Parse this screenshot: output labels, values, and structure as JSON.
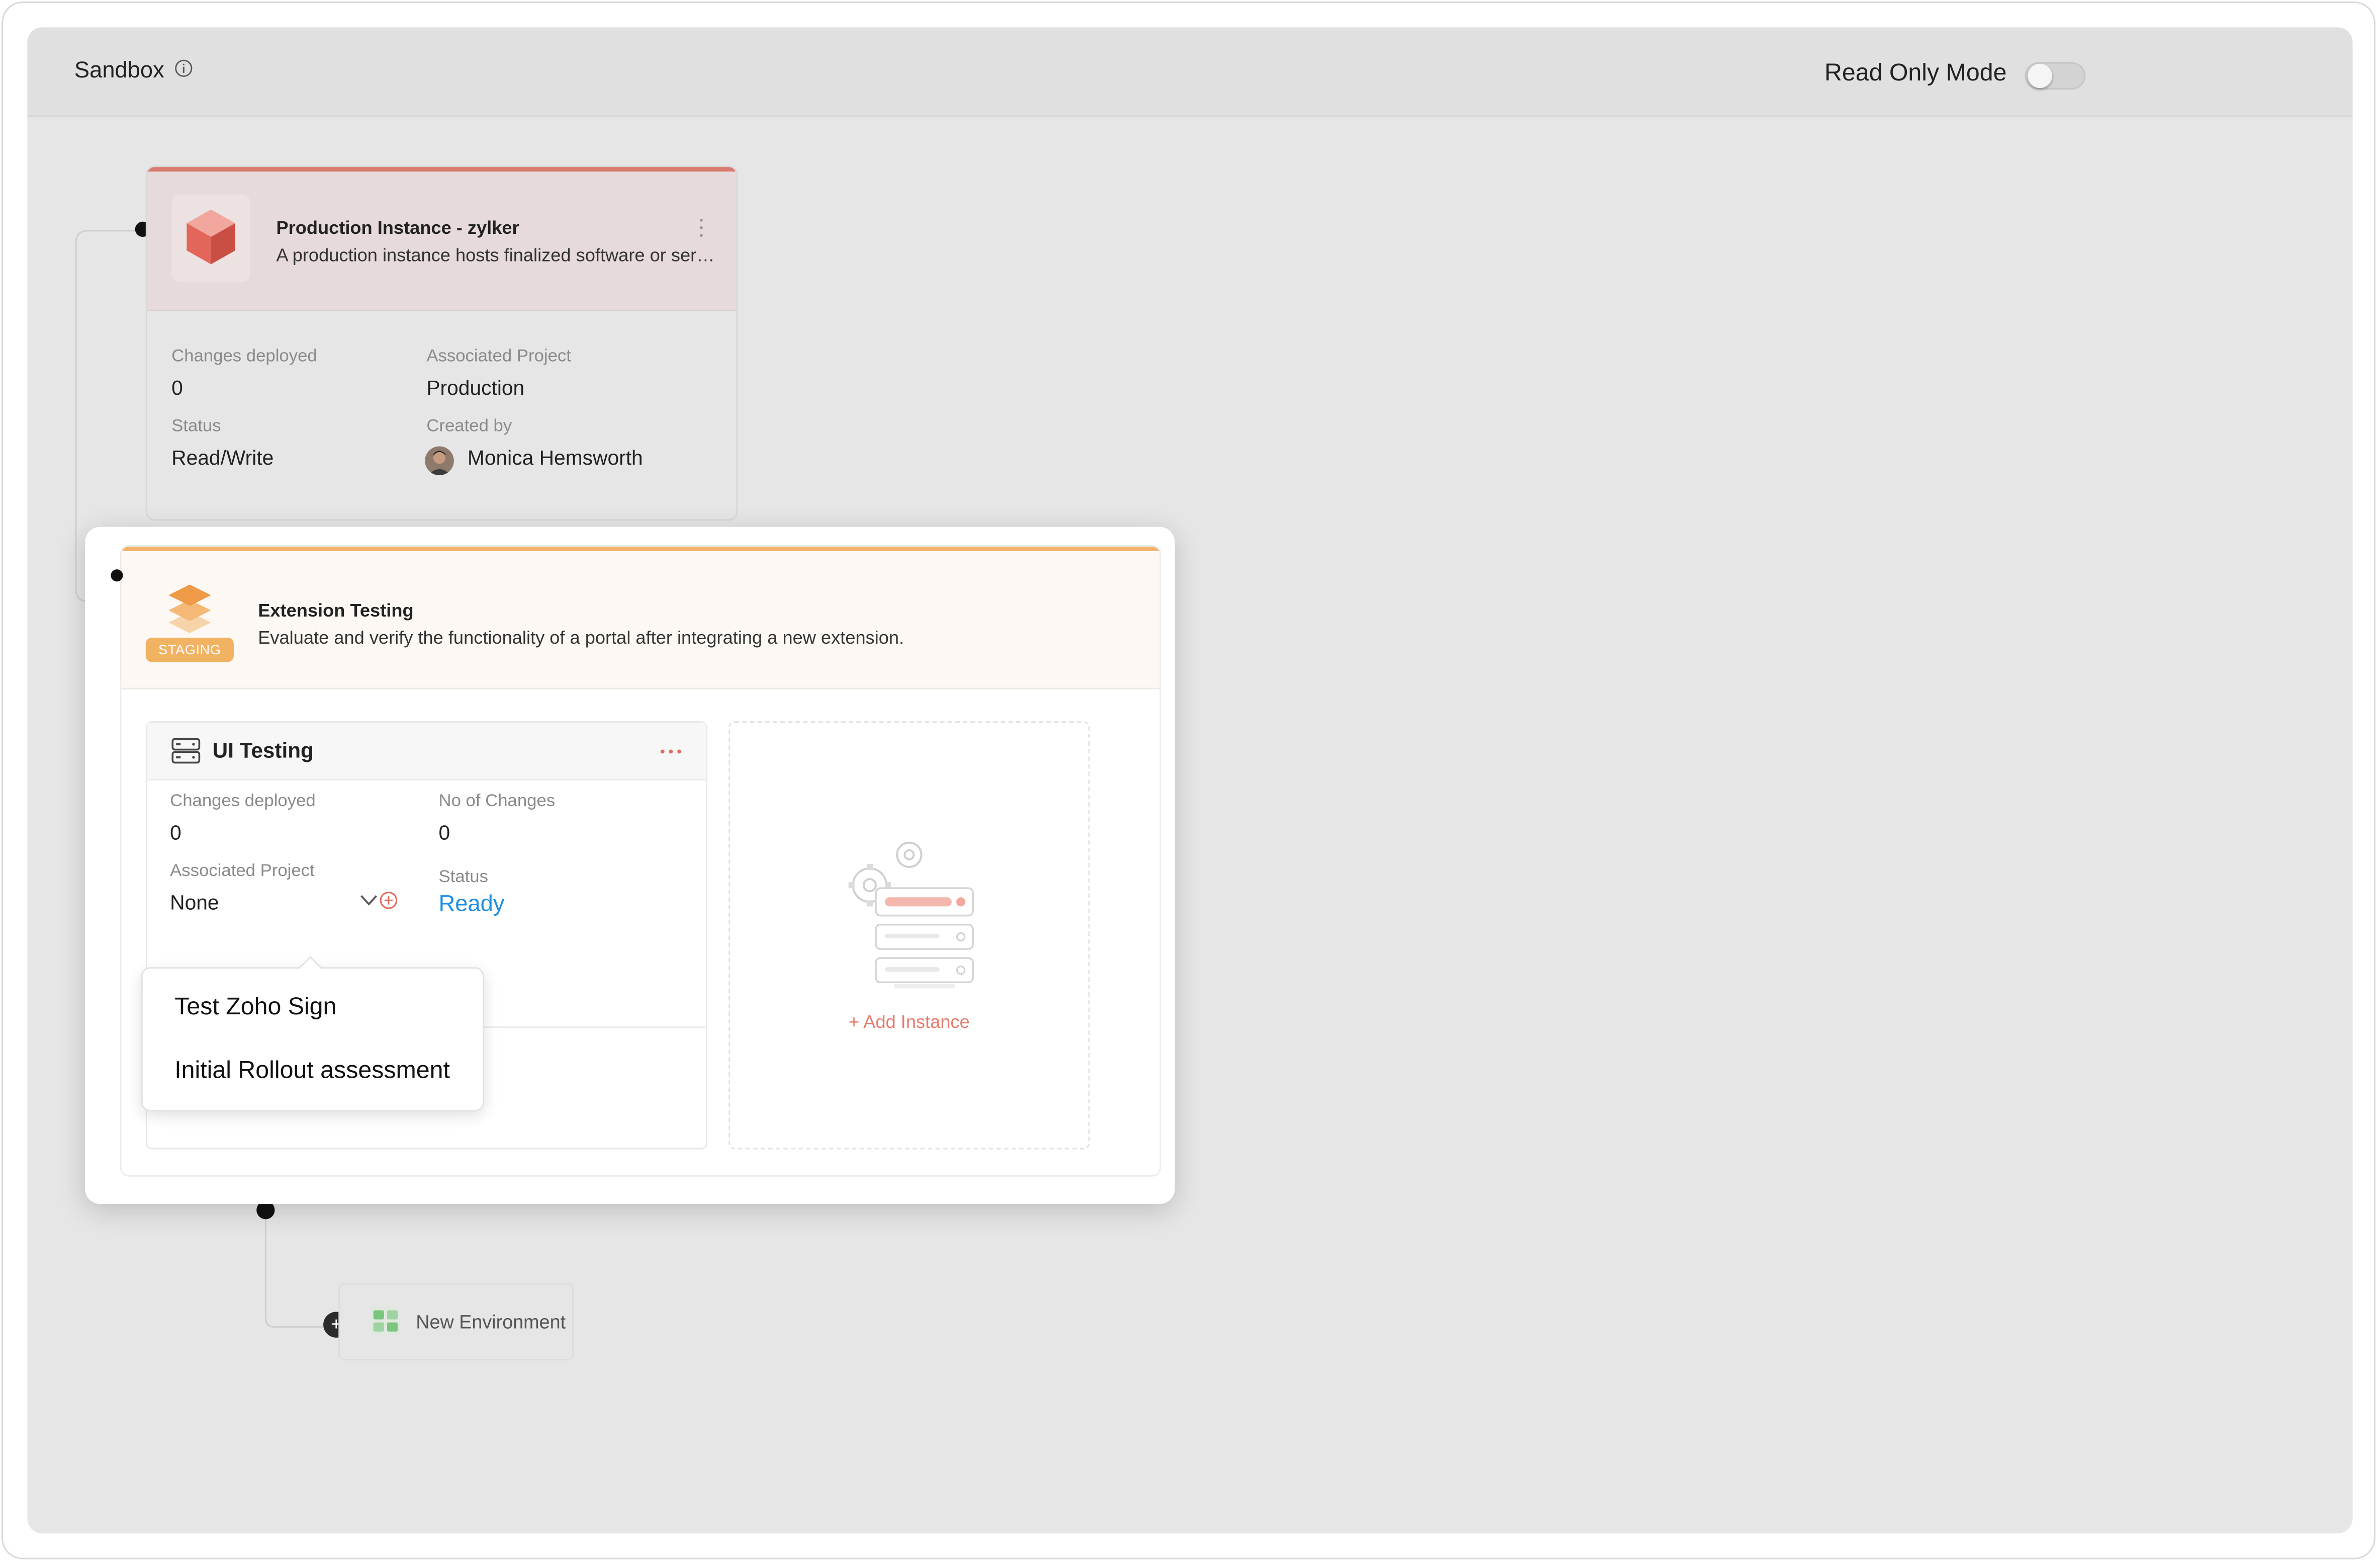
{
  "header": {
    "title": "Sandbox",
    "read_only_label": "Read Only Mode",
    "read_only_enabled": false
  },
  "production": {
    "title": "Production Instance - zylker",
    "description": "A production instance hosts finalized software or serv...",
    "fields": {
      "changes_deployed_label": "Changes deployed",
      "changes_deployed_value": "0",
      "associated_project_label": "Associated Project",
      "associated_project_value": "Production",
      "status_label": "Status",
      "status_value": "Read/Write",
      "created_by_label": "Created by",
      "created_by_value": "Monica Hemsworth"
    },
    "accent_color": "#d97a70"
  },
  "staging": {
    "badge": "STAGING",
    "title": "Extension Testing",
    "description": "Evaluate and verify the functionality of a portal after integrating a new extension.",
    "accent_color": "#f2b36a",
    "instance": {
      "title": "UI Testing",
      "changes_deployed_label": "Changes deployed",
      "changes_deployed_value": "0",
      "no_of_changes_label": "No of Changes",
      "no_of_changes_value": "0",
      "associated_project_label": "Associated Project",
      "associated_project_value": "None",
      "status_label": "Status",
      "status_value": "Ready",
      "status_color": "#1d8fe0"
    },
    "add_instance_label": "+ Add Instance"
  },
  "project_dropdown": {
    "options": [
      "Test Zoho Sign",
      "Initial Rollout assessment"
    ]
  },
  "new_environment": {
    "label": "New Environment",
    "add_symbol": "+"
  }
}
